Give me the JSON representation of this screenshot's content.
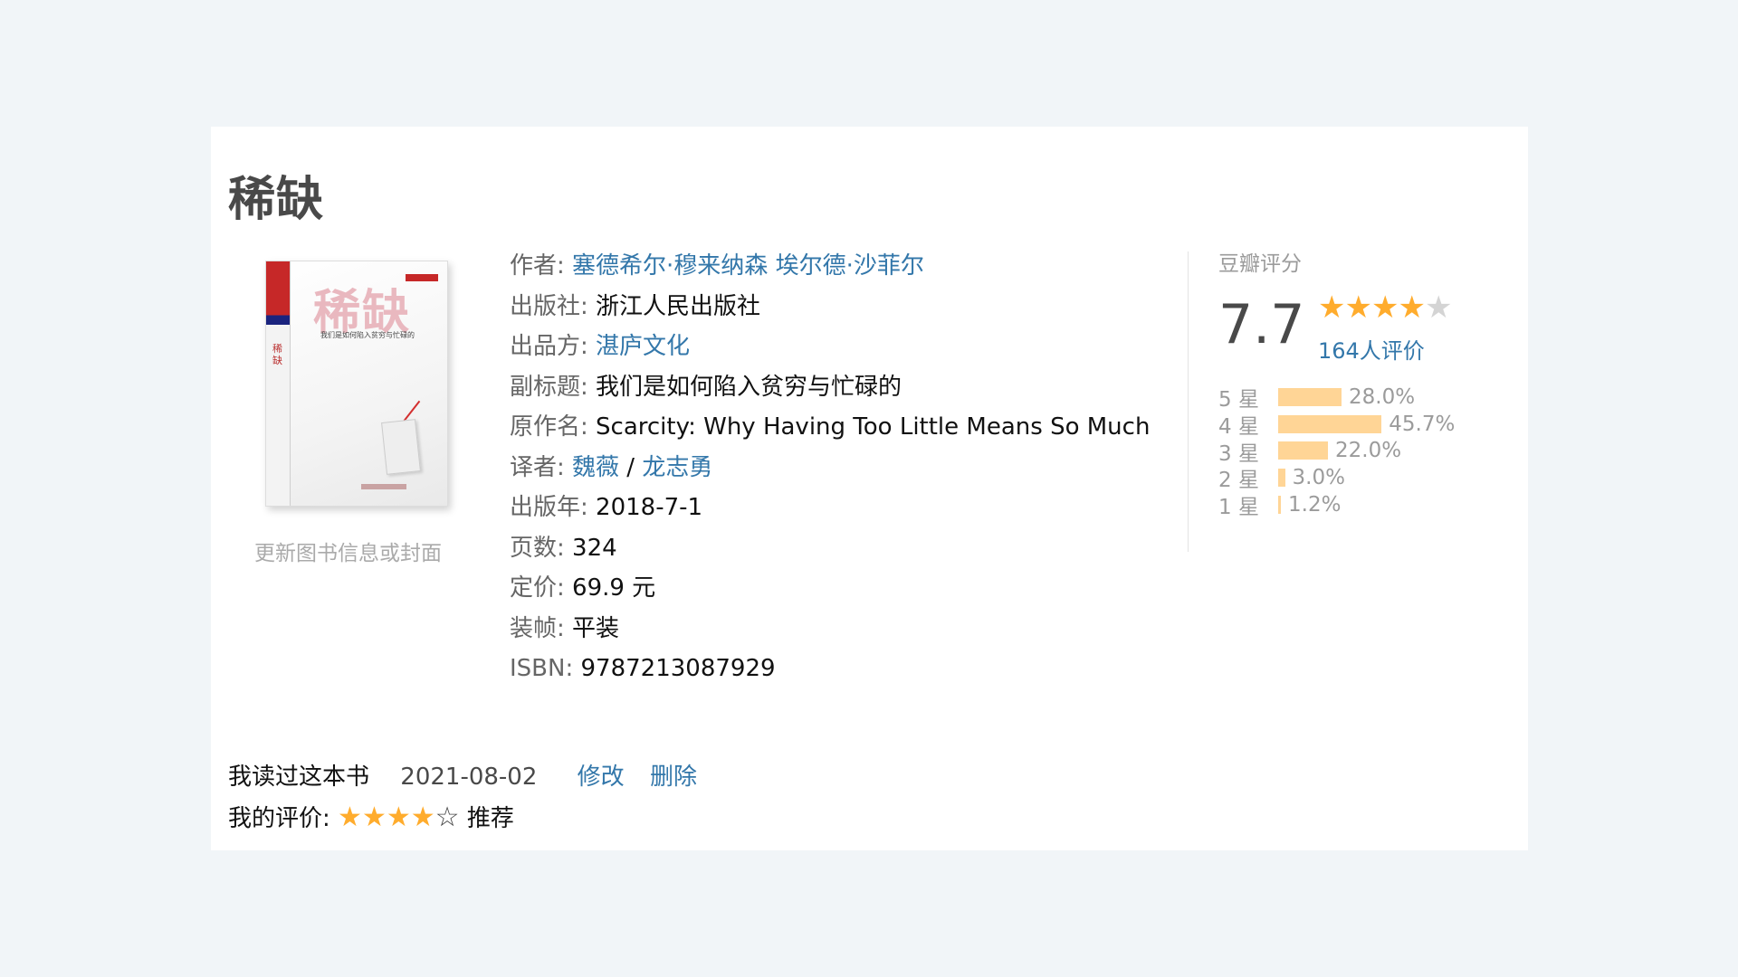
{
  "book": {
    "title": "稀缺",
    "cover": {
      "title": "稀缺",
      "subtitle": "我们是如何陷入贫穷与忙碌的"
    },
    "update_link": "更新图书信息或封面",
    "info": {
      "author_label": "作者:",
      "author_1": "塞德希尔·穆来纳森",
      "author_2": "埃尔德·沙菲尔",
      "publisher_label": "出版社:",
      "publisher": "浙江人民出版社",
      "producer_label": "出品方:",
      "producer": "湛庐文化",
      "subtitle_label": "副标题:",
      "subtitle": "我们是如何陷入贫穷与忙碌的",
      "original_label": "原作名:",
      "original": "Scarcity: Why Having Too Little Means So Much",
      "translator_label": "译者:",
      "translator_1": "魏薇",
      "translator_sep": " / ",
      "translator_2": "龙志勇",
      "pubdate_label": "出版年:",
      "pubdate": "2018-7-1",
      "pages_label": "页数:",
      "pages": "324",
      "price_label": "定价:",
      "price": "69.9 元",
      "binding_label": "装帧:",
      "binding": "平装",
      "isbn_label": "ISBN:",
      "isbn": "9787213087929"
    }
  },
  "rating": {
    "label": "豆瓣评分",
    "score": "7.7",
    "stars_value": 4,
    "stars_max": 5,
    "votes": "164人评价",
    "accent_color": "#ffac2d",
    "bar_color": "#ffd596",
    "distribution": [
      {
        "level": "5 星",
        "percent": "28.0%",
        "value": 28.0
      },
      {
        "level": "4 星",
        "percent": "45.7%",
        "value": 45.7
      },
      {
        "level": "3 星",
        "percent": "22.0%",
        "value": 22.0
      },
      {
        "level": "2 星",
        "percent": "3.0%",
        "value": 3.0
      },
      {
        "level": "1 星",
        "percent": "1.2%",
        "value": 1.2
      }
    ]
  },
  "my_reading": {
    "status": "我读过这本书",
    "date": "2021-08-02",
    "edit": "修改",
    "delete": "删除",
    "my_rating_label": "我的评价:",
    "my_stars_value": 4,
    "my_stars_max": 5,
    "my_rating_text": "推荐"
  },
  "link_color": "#3377aa"
}
